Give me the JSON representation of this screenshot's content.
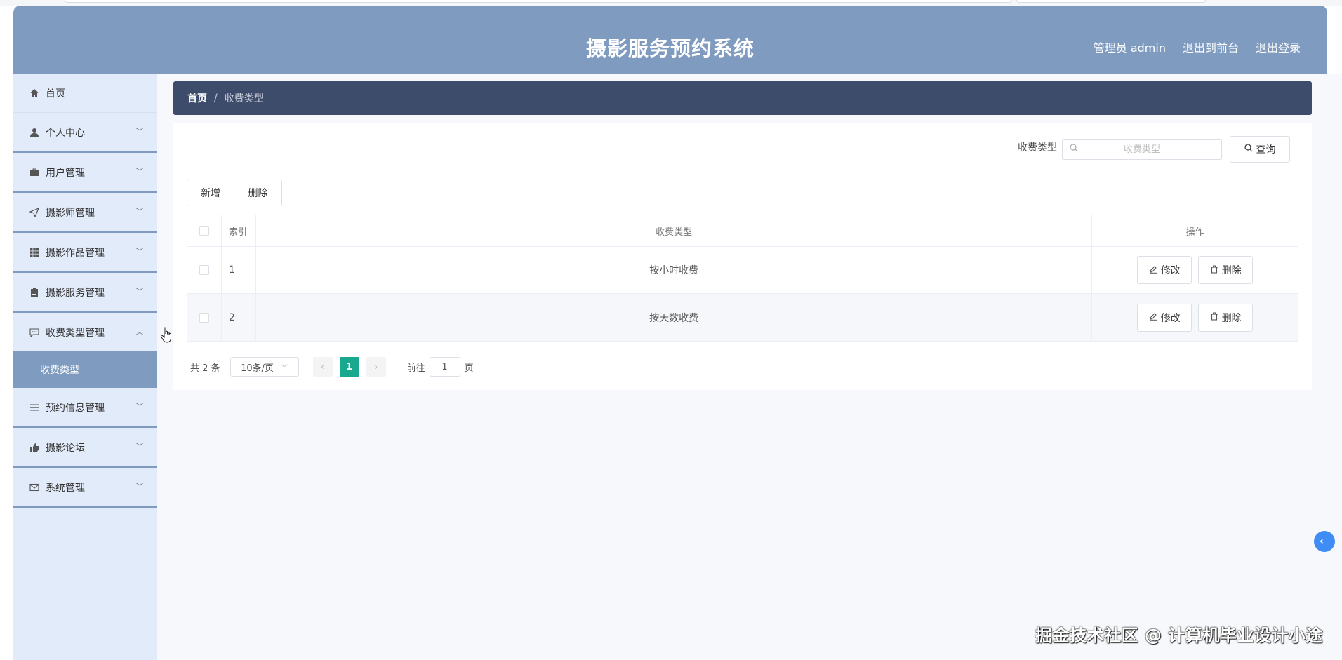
{
  "header": {
    "title": "摄影服务预约系统",
    "admin_label": "管理员 admin",
    "front_link": "退出到前台",
    "logout_link": "退出登录"
  },
  "sidebar": {
    "items": [
      {
        "label": "首页",
        "icon": "home-icon"
      },
      {
        "label": "个人中心",
        "icon": "user-icon"
      },
      {
        "label": "用户管理",
        "icon": "briefcase-icon"
      },
      {
        "label": "摄影师管理",
        "icon": "send-icon"
      },
      {
        "label": "摄影作品管理",
        "icon": "grid-icon"
      },
      {
        "label": "摄影服务管理",
        "icon": "clipboard-icon"
      },
      {
        "label": "收费类型管理",
        "icon": "chat-icon"
      },
      {
        "label": "预约信息管理",
        "icon": "list-icon"
      },
      {
        "label": "摄影论坛",
        "icon": "thumbs-up-icon"
      },
      {
        "label": "系统管理",
        "icon": "mail-icon"
      }
    ],
    "sub_active": "收费类型"
  },
  "breadcrumb": {
    "home": "首页",
    "separator": "/",
    "current": "收费类型"
  },
  "search": {
    "label": "收费类型",
    "placeholder": "收费类型",
    "button": "查询"
  },
  "toolbar": {
    "add": "新增",
    "delete": "删除"
  },
  "table": {
    "headers": {
      "index": "索引",
      "type": "收费类型",
      "ops": "操作"
    },
    "rows": [
      {
        "index": "1",
        "type": "按小时收费"
      },
      {
        "index": "2",
        "type": "按天数收费"
      }
    ],
    "edit_label": "修改",
    "delete_label": "删除"
  },
  "pagination": {
    "total": "共 2 条",
    "page_size": "10条/页",
    "current_page": "1",
    "goto_label": "前往",
    "goto_value": "1",
    "page_suffix": "页"
  },
  "watermark": "掘金技术社区 @ 计算机毕业设计小途",
  "colors": {
    "header_bg": "#7f9bc0",
    "breadcrumb_bg": "#3d4c6b",
    "sidebar_bg": "#e2ebfa",
    "active_page": "#17a88e",
    "toggle": "#3f8cf5"
  }
}
